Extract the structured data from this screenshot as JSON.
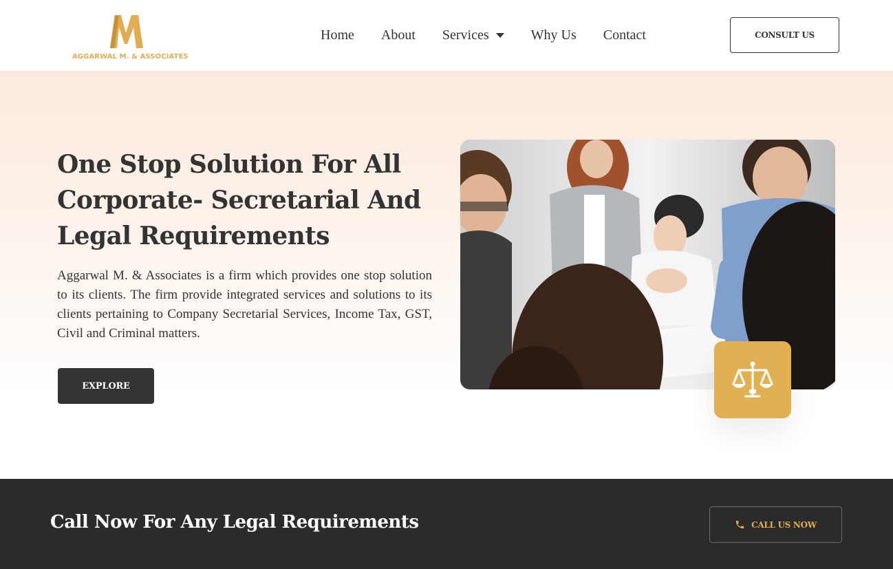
{
  "brand": {
    "logo_text": "AGGARWAL M. & ASSOCIATES",
    "accent_color": "#e1ad51",
    "dark_color": "#333333"
  },
  "nav": {
    "items": [
      {
        "label": "Home"
      },
      {
        "label": "About"
      },
      {
        "label": "Services",
        "has_dropdown": true
      },
      {
        "label": "Why Us"
      },
      {
        "label": "Contact"
      }
    ],
    "consult_label": "CONSULT US"
  },
  "hero": {
    "title": "One Stop Solution For All Corporate- Secretarial And Legal Requirements",
    "description": "Aggarwal M. & Associates is a firm which provides one stop solution to its clients. The firm provide integrated services and solutions to its clients pertaining to Company Secretarial Services, Income Tax, GST, Civil and Criminal matters.",
    "explore_label": "EXPLORE",
    "badge_icon": "scales-of-justice-icon"
  },
  "cta": {
    "title": "Call Now For Any Legal Requirements",
    "button_label": "CALL US NOW",
    "button_icon": "phone-icon"
  }
}
